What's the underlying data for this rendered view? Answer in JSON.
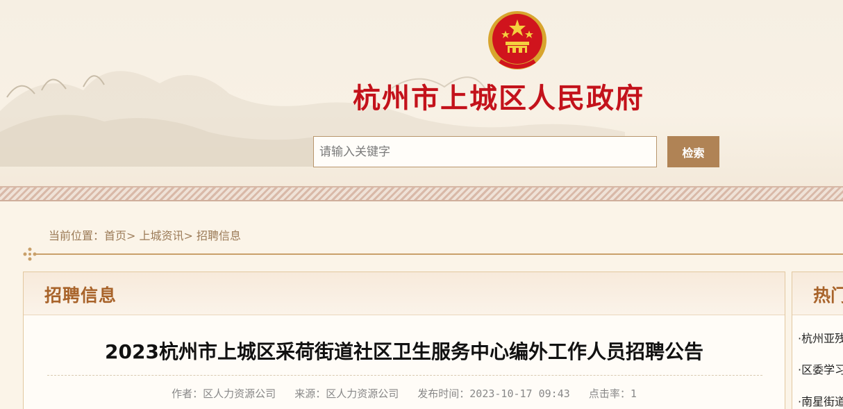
{
  "header": {
    "site_title": "杭州市上城区人民政府",
    "search_placeholder": "请输入关键字",
    "search_button": "检索",
    "emblem_icon": "national-emblem"
  },
  "breadcrumb": {
    "prefix": "当前位置：",
    "items": [
      "首页",
      "上城资讯",
      "招聘信息"
    ],
    "separator": ">"
  },
  "main": {
    "section_title": "招聘信息",
    "article": {
      "title": "2023杭州市上城区采荷街道社区卫生服务中心编外工作人员招聘公告",
      "author_label": "作者：",
      "author": "区人力资源公司",
      "source_label": "来源：",
      "source": "区人力资源公司",
      "date_label": "发布时间：",
      "date": "2023-10-17 09:43",
      "clicks_label": "点击率：",
      "clicks": "1"
    }
  },
  "sidebar": {
    "title": "热门",
    "items": [
      "·杭州亚残",
      "·区委学习",
      "·南星街道"
    ]
  },
  "colors": {
    "title_red": "#c3121b",
    "accent_brown": "#b08355",
    "section_orange": "#a8632a",
    "page_bg": "#fbf4e8"
  }
}
